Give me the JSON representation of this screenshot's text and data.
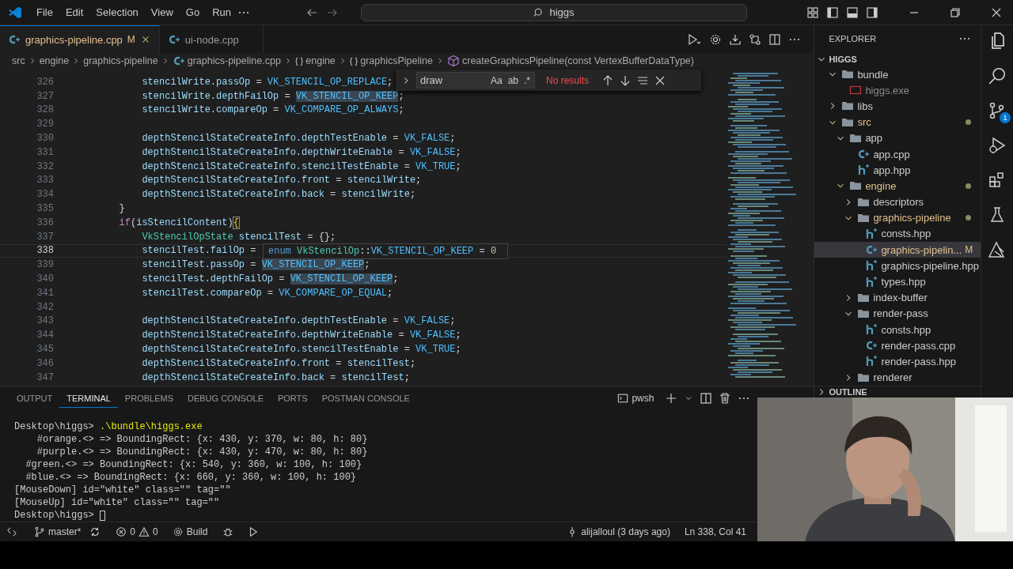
{
  "title_bar": {
    "menu": [
      "File",
      "Edit",
      "Selection",
      "View",
      "Go",
      "Run"
    ],
    "search": "higgs"
  },
  "tabs": [
    {
      "label": "graphics-pipeline.cpp",
      "badge": "M",
      "selected": true
    },
    {
      "label": "ui-node.cpp",
      "selected": false
    }
  ],
  "breadcrumb": [
    {
      "label": "src",
      "kind": "folder"
    },
    {
      "label": "engine",
      "kind": "folder"
    },
    {
      "label": "graphics-pipeline",
      "kind": "folder"
    },
    {
      "label": "graphics-pipeline.cpp",
      "kind": "cpp"
    },
    {
      "label": "engine",
      "kind": "namespace",
      "icon": "{ }"
    },
    {
      "label": "graphicsPipeline",
      "kind": "namespace",
      "icon": "{ }"
    },
    {
      "label": "createGraphicsPipeline(const VertexBufferDataType)",
      "kind": "method"
    }
  ],
  "editor": {
    "lines": [
      {
        "number": "326",
        "current": false,
        "tokens": [
          {
            "text": "            stencilWrite.passOp",
            "kind": "var"
          },
          {
            "text": " = ",
            "kind": "op"
          },
          {
            "text": "VK_STENCIL_OP_REPLACE",
            "kind": "const"
          },
          {
            "text": ";",
            "kind": "op"
          }
        ]
      },
      {
        "number": "327",
        "current": false,
        "tokens": [
          {
            "text": "            stencilWrite.depthFailOp",
            "kind": "var"
          },
          {
            "text": " = ",
            "kind": "op"
          },
          {
            "text": "VK_STENCIL_OP_KEEP",
            "kind": "const-hl"
          },
          {
            "text": ";",
            "kind": "op"
          }
        ]
      },
      {
        "number": "328",
        "current": false,
        "tokens": [
          {
            "text": "            stencilWrite.compareOp",
            "kind": "var"
          },
          {
            "text": " = ",
            "kind": "op"
          },
          {
            "text": "VK_COMPARE_OP_ALWAYS",
            "kind": "const"
          },
          {
            "text": ";",
            "kind": "op"
          }
        ]
      },
      {
        "number": "329",
        "current": false
      },
      {
        "number": "330",
        "current": false,
        "tokens": [
          {
            "text": "            depthStencilStateCreateInfo.depthTestEnable",
            "kind": "var"
          },
          {
            "text": " = ",
            "kind": "op"
          },
          {
            "text": "VK_FALSE",
            "kind": "const"
          },
          {
            "text": ";",
            "kind": "op"
          }
        ]
      },
      {
        "number": "331",
        "current": false,
        "tokens": [
          {
            "text": "            depthStencilStateCreateInfo.depthWriteEnable",
            "kind": "var"
          },
          {
            "text": " = ",
            "kind": "op"
          },
          {
            "text": "VK_FALSE",
            "kind": "const"
          },
          {
            "text": ";",
            "kind": "op"
          }
        ]
      },
      {
        "number": "332",
        "current": false,
        "tokens": [
          {
            "text": "            depthStencilStateCreateInfo.stencilTestEnable",
            "kind": "var"
          },
          {
            "text": " = ",
            "kind": "op"
          },
          {
            "text": "VK_TRUE",
            "kind": "const"
          },
          {
            "text": ";",
            "kind": "op"
          }
        ]
      },
      {
        "number": "333",
        "current": false,
        "tokens": [
          {
            "text": "            depthStencilStateCreateInfo.front",
            "kind": "var"
          },
          {
            "text": " = ",
            "kind": "op"
          },
          {
            "text": "stencilWrite",
            "kind": "var"
          },
          {
            "text": ";",
            "kind": "op"
          }
        ]
      },
      {
        "number": "334",
        "current": false,
        "tokens": [
          {
            "text": "            depthStencilStateCreateInfo.back",
            "kind": "var"
          },
          {
            "text": " = ",
            "kind": "op"
          },
          {
            "text": "stencilWrite",
            "kind": "var"
          },
          {
            "text": ";",
            "kind": "op"
          }
        ]
      },
      {
        "number": "335",
        "current": false,
        "tokens": [
          {
            "text": "        }",
            "kind": "op"
          }
        ]
      },
      {
        "number": "336",
        "current": false,
        "tokens": [
          {
            "text": "        if",
            "kind": "kw"
          },
          {
            "text": "(",
            "kind": "op"
          },
          {
            "text": "isStencilContent",
            "kind": "var"
          },
          {
            "text": ")",
            "kind": "op"
          },
          {
            "text": "{",
            "kind": "bracket"
          }
        ]
      },
      {
        "number": "337",
        "current": false,
        "tokens": [
          {
            "text": "            VkStencilOpState ",
            "kind": "type"
          },
          {
            "text": "stencilTest",
            "kind": "var"
          },
          {
            "text": " = {};",
            "kind": "op"
          }
        ]
      },
      {
        "number": "338",
        "current": true,
        "tokens": [
          {
            "text": "            stencilTest.failOp",
            "kind": "var"
          },
          {
            "text": " =",
            "kind": "op"
          }
        ]
      },
      {
        "number": "339",
        "current": false,
        "tokens": [
          {
            "text": "            stencilTest.passOp",
            "kind": "var"
          },
          {
            "text": " = ",
            "kind": "op"
          },
          {
            "text": "VK_STENCIL_OP_KEEP",
            "kind": "const-hl"
          },
          {
            "text": ";",
            "kind": "op"
          }
        ]
      },
      {
        "number": "340",
        "current": false,
        "tokens": [
          {
            "text": "            stencilTest.depthFailOp",
            "kind": "var"
          },
          {
            "text": " = ",
            "kind": "op"
          },
          {
            "text": "VK_STENCIL_OP_KEEP",
            "kind": "const-hl"
          },
          {
            "text": ";",
            "kind": "op"
          }
        ]
      },
      {
        "number": "341",
        "current": false,
        "tokens": [
          {
            "text": "            stencilTest.compareOp",
            "kind": "var"
          },
          {
            "text": " = ",
            "kind": "op"
          },
          {
            "text": "VK_COMPARE_OP_EQUAL",
            "kind": "const"
          },
          {
            "text": ";",
            "kind": "op"
          }
        ]
      },
      {
        "number": "342",
        "current": false
      },
      {
        "number": "343",
        "current": false,
        "tokens": [
          {
            "text": "            depthStencilStateCreateInfo.depthTestEnable",
            "kind": "var"
          },
          {
            "text": " = ",
            "kind": "op"
          },
          {
            "text": "VK_FALSE",
            "kind": "const"
          },
          {
            "text": ";",
            "kind": "op"
          }
        ]
      },
      {
        "number": "344",
        "current": false,
        "tokens": [
          {
            "text": "            depthStencilStateCreateInfo.depthWriteEnable",
            "kind": "var"
          },
          {
            "text": " = ",
            "kind": "op"
          },
          {
            "text": "VK_FALSE",
            "kind": "const"
          },
          {
            "text": ";",
            "kind": "op"
          }
        ]
      },
      {
        "number": "345",
        "current": false,
        "tokens": [
          {
            "text": "            depthStencilStateCreateInfo.stencilTestEnable",
            "kind": "var"
          },
          {
            "text": " = ",
            "kind": "op"
          },
          {
            "text": "VK_TRUE",
            "kind": "const"
          },
          {
            "text": ";",
            "kind": "op"
          }
        ]
      },
      {
        "number": "346",
        "current": false,
        "tokens": [
          {
            "text": "            depthStencilStateCreateInfo.front",
            "kind": "var"
          },
          {
            "text": " = ",
            "kind": "op"
          },
          {
            "text": "stencilTest",
            "kind": "var"
          },
          {
            "text": ";",
            "kind": "op"
          }
        ]
      },
      {
        "number": "347",
        "current": false,
        "tokens": [
          {
            "text": "            depthStencilStateCreateInfo.back",
            "kind": "var"
          },
          {
            "text": " = ",
            "kind": "op"
          },
          {
            "text": "stencilTest",
            "kind": "var"
          },
          {
            "text": ";",
            "kind": "op"
          }
        ]
      }
    ]
  },
  "find_widget": {
    "value": "draw",
    "options": [
      "Aa",
      "ab",
      ".*"
    ],
    "status": "No results"
  },
  "hover": {
    "tokens": [
      {
        "text": "enum ",
        "kind": "kw2"
      },
      {
        "text": "VkStencilOp",
        "kind": "type"
      },
      {
        "text": "::",
        "kind": "op"
      },
      {
        "text": "VK_STENCIL_OP_KEEP",
        "kind": "const"
      },
      {
        "text": " = ",
        "kind": "op"
      },
      {
        "text": "0",
        "kind": "num"
      }
    ]
  },
  "explorer": {
    "title": "EXPLORER",
    "root": "HIGGS",
    "outline": "OUTLINE",
    "tree": [
      {
        "label": "bundle",
        "kind": "folder",
        "expanded": true,
        "modified": false,
        "selected": false,
        "children": [
          {
            "label": "higgs.exe",
            "kind": "exe",
            "modified": false,
            "selected": false
          }
        ]
      },
      {
        "label": "libs",
        "kind": "folder",
        "expanded": false,
        "modified": false,
        "selected": false
      },
      {
        "label": "src",
        "kind": "folder",
        "expanded": true,
        "modified": true,
        "selected": false,
        "children": [
          {
            "label": "app",
            "kind": "folder",
            "expanded": true,
            "modified": false,
            "selected": false,
            "children": [
              {
                "label": "app.cpp",
                "kind": "cpp",
                "modified": false,
                "selected": false
              },
              {
                "label": "app.hpp",
                "kind": "hpp",
                "modified": false,
                "selected": false
              }
            ]
          },
          {
            "label": "engine",
            "kind": "folder",
            "expanded": true,
            "modified": true,
            "selected": false,
            "children": [
              {
                "label": "descriptors",
                "kind": "folder",
                "expanded": false,
                "modified": false,
                "selected": false
              },
              {
                "label": "graphics-pipeline",
                "kind": "folder",
                "expanded": true,
                "modified": true,
                "selected": false,
                "children": [
                  {
                    "label": "consts.hpp",
                    "kind": "hpp",
                    "modified": false,
                    "selected": false
                  },
                  {
                    "label": "graphics-pipelin...",
                    "kind": "cpp",
                    "modified": true,
                    "badge": "M",
                    "selected": true
                  },
                  {
                    "label": "graphics-pipeline.hpp",
                    "kind": "hpp",
                    "modified": false,
                    "selected": false
                  },
                  {
                    "label": "types.hpp",
                    "kind": "hpp",
                    "modified": false,
                    "selected": false
                  }
                ]
              },
              {
                "label": "index-buffer",
                "kind": "folder",
                "expanded": false,
                "modified": false,
                "selected": false
              },
              {
                "label": "render-pass",
                "kind": "folder",
                "expanded": true,
                "modified": false,
                "selected": false,
                "children": [
                  {
                    "label": "consts.hpp",
                    "kind": "hpp",
                    "modified": false,
                    "selected": false
                  },
                  {
                    "label": "render-pass.cpp",
                    "kind": "cpp",
                    "modified": false,
                    "selected": false
                  },
                  {
                    "label": "render-pass.hpp",
                    "kind": "hpp",
                    "modified": false,
                    "selected": false
                  }
                ]
              },
              {
                "label": "renderer",
                "kind": "folder",
                "expanded": false,
                "modified": false,
                "selected": false
              }
            ]
          }
        ]
      }
    ]
  },
  "activity_bar": {
    "source_control_badge": "1"
  },
  "panel": {
    "tabs": [
      {
        "label": "OUTPUT",
        "selected": false
      },
      {
        "label": "TERMINAL",
        "selected": true
      },
      {
        "label": "PROBLEMS",
        "selected": false
      },
      {
        "label": "DEBUG CONSOLE",
        "selected": false
      },
      {
        "label": "PORTS",
        "selected": false
      },
      {
        "label": "POSTMAN CONSOLE",
        "selected": false
      }
    ],
    "shell": "pwsh",
    "lines": [
      {
        "cursor": false,
        "tokens": [
          {
            "text": "Desktop\\higgs> ",
            "kind": "text"
          },
          {
            "text": ".\\bundle\\higgs.exe",
            "kind": "command"
          }
        ]
      },
      {
        "cursor": false,
        "tokens": [
          {
            "text": "    #orange.<> => BoundingRect: {x: 430, y: 370, w: 80, h: 80}",
            "kind": "text"
          }
        ]
      },
      {
        "cursor": false,
        "tokens": [
          {
            "text": "    #purple.<> => BoundingRect: {x: 430, y: 470, w: 80, h: 80}",
            "kind": "text"
          }
        ]
      },
      {
        "cursor": false,
        "tokens": [
          {
            "text": "  #green.<> => BoundingRect: {x: 540, y: 360, w: 100, h: 100}",
            "kind": "text"
          }
        ]
      },
      {
        "cursor": false,
        "tokens": [
          {
            "text": "  #blue.<> => BoundingRect: {x: 660, y: 360, w: 100, h: 100}",
            "kind": "text"
          }
        ]
      },
      {
        "cursor": false,
        "tokens": [
          {
            "text": "[MouseDown] id=\"white\" class=\"\" tag=\"\"",
            "kind": "text"
          }
        ]
      },
      {
        "cursor": false,
        "tokens": [
          {
            "text": "[MouseUp] id=\"white\" class=\"\" tag=\"\"",
            "kind": "text"
          }
        ]
      },
      {
        "cursor": true,
        "tokens": [
          {
            "text": "Desktop\\higgs>",
            "kind": "text"
          }
        ]
      }
    ]
  },
  "status_bar": {
    "branch": "master*",
    "errors": "0",
    "warnings": "0",
    "task": "Build",
    "blame": "alijalloul (3 days ago)",
    "position": "Ln 338, Col 41"
  }
}
